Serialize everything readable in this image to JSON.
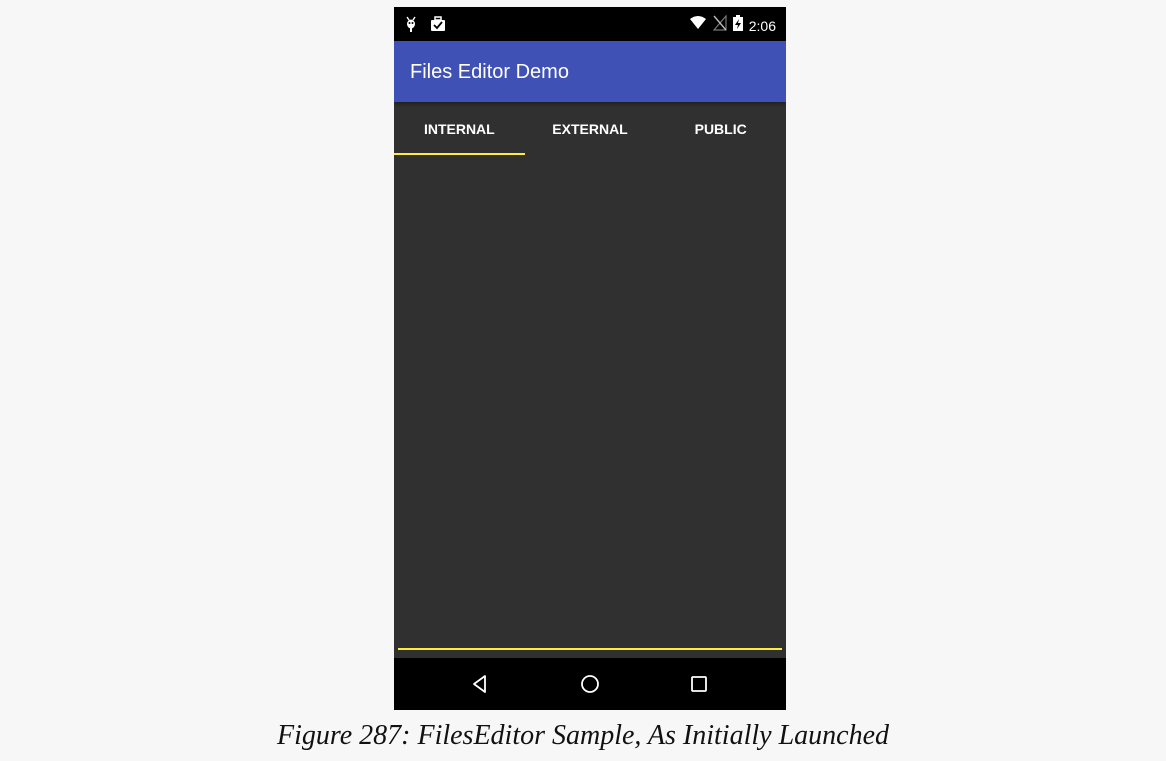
{
  "status_bar": {
    "time": "2:06",
    "icons": [
      "android-debug-icon",
      "briefcase-check-icon",
      "wifi-icon",
      "no-sim-icon",
      "battery-charging-icon"
    ]
  },
  "app_bar": {
    "title": "Files Editor Demo",
    "color": "#3f51b5"
  },
  "tabs": [
    {
      "label": "INTERNAL",
      "selected": true
    },
    {
      "label": "EXTERNAL",
      "selected": false
    },
    {
      "label": "PUBLIC",
      "selected": false
    }
  ],
  "editor": {
    "value": ""
  },
  "nav_bar": {
    "buttons": [
      "back-icon",
      "home-icon",
      "recents-icon"
    ]
  },
  "accent_color": "#ffeb3b",
  "background_color": "#303030",
  "caption": "Figure 287: FilesEditor Sample, As Initially Launched"
}
